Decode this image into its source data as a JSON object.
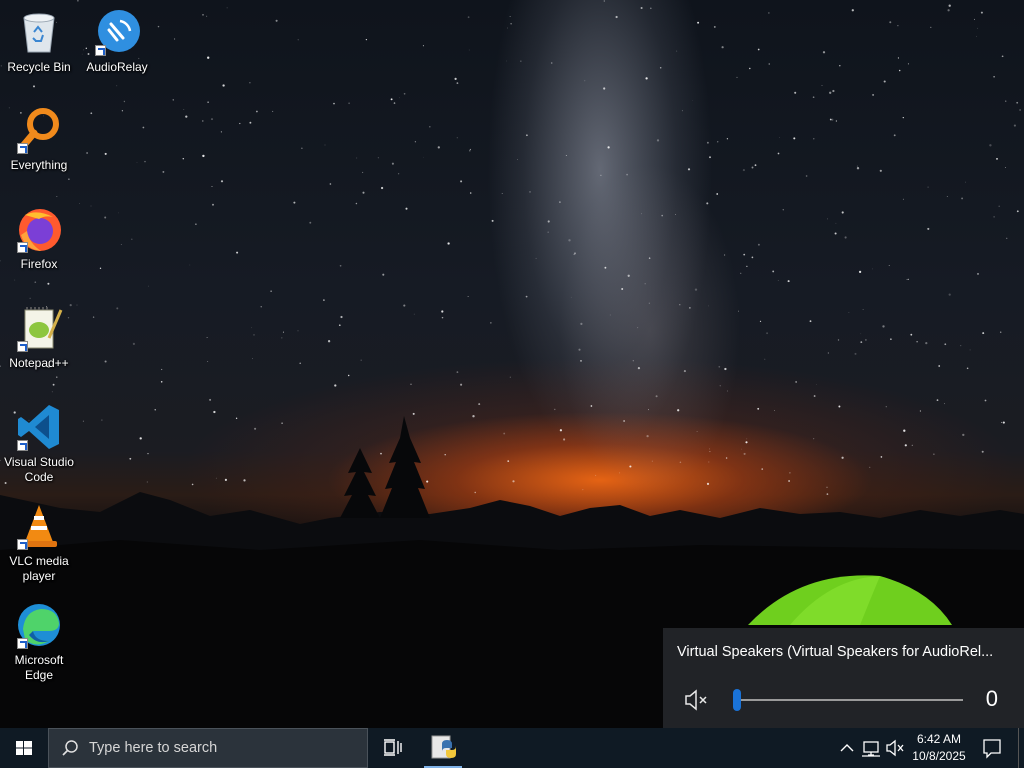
{
  "desktop": {
    "icons": [
      {
        "label": "Recycle Bin",
        "icon": "recycle-bin-icon"
      },
      {
        "label": "AudioRelay",
        "icon": "audiorelay-icon"
      },
      {
        "label": "Everything",
        "icon": "everything-search-icon"
      },
      {
        "label": "Firefox",
        "icon": "firefox-icon"
      },
      {
        "label": "Notepad++",
        "icon": "notepad-plus-plus-icon"
      },
      {
        "label": "Visual Studio Code",
        "icon": "vscode-icon"
      },
      {
        "label": "VLC media player",
        "icon": "vlc-icon"
      },
      {
        "label": "Microsoft Edge",
        "icon": "edge-icon"
      }
    ]
  },
  "volume_flyout": {
    "device_name": "Virtual Speakers (Virtual Speakers for AudioRel...",
    "volume_level": 0,
    "volume_display": "0",
    "muted": true,
    "accent_color": "#1a73d8"
  },
  "taskbar": {
    "search_placeholder": "Type here to search",
    "pinned_apps": [
      {
        "name": "task-view-icon"
      },
      {
        "name": "python-app-icon",
        "active": true
      }
    ],
    "tray_icons": [
      "chevron-up-icon",
      "network-icon",
      "volume-muted-icon"
    ],
    "clock": {
      "time": "6:42 AM",
      "date": "10/8/2025"
    },
    "background_color": "#0f1a24"
  }
}
